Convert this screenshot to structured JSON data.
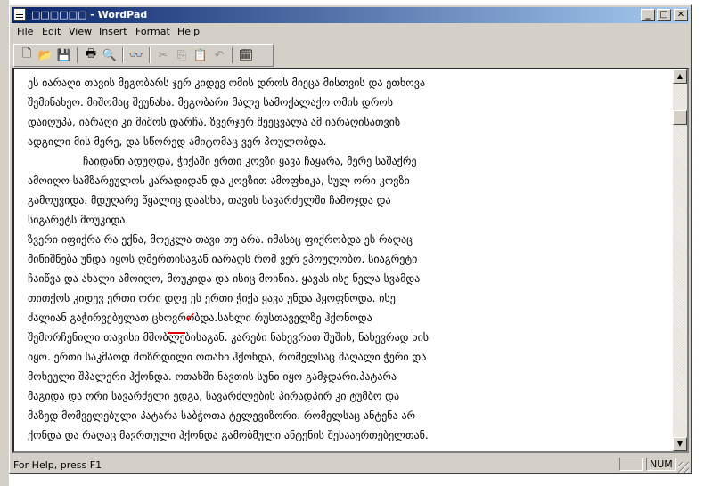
{
  "window": {
    "title": "□□□□□□ - WordPad",
    "minimize_icon": "minimize-icon",
    "maximize_icon": "maximize-icon",
    "close_icon": "close-icon"
  },
  "menu": [
    "File",
    "Edit",
    "View",
    "Insert",
    "Format",
    "Help"
  ],
  "toolbar": [
    {
      "name": "new-icon",
      "glyph": "🗋"
    },
    {
      "name": "open-icon",
      "glyph": "📂"
    },
    {
      "name": "save-icon",
      "glyph": "💾"
    },
    {
      "name": "print-icon",
      "glyph": "🖶"
    },
    {
      "name": "print-preview-icon",
      "glyph": "🔍"
    },
    {
      "name": "find-icon",
      "glyph": "👓"
    },
    {
      "name": "cut-icon",
      "glyph": "✂"
    },
    {
      "name": "copy-icon",
      "glyph": "⎘"
    },
    {
      "name": "paste-icon",
      "glyph": "📋"
    },
    {
      "name": "undo-icon",
      "glyph": "↶"
    },
    {
      "name": "date-time-icon",
      "glyph": "🗓"
    }
  ],
  "document": {
    "lines": [
      "ეს იარაღი თავის მეგობარს ჯერ კიდევ ომის დროს მიეცა მისთვის და ეთხოვა",
      "შემინახეო. მიშომაც შეუნახა. მეგობარი მალე სამოქალაქო ომის დროს",
      "დაიღუპა, იარაღი კი მიშოს დარჩა. ზვერჯერ შეეცვალა ამ იარაღისათვის",
      "ადგილი მის მერე, და სწორედ ამიტომაც ვერ პოულობდა.",
      "ჩაიდანი ადუღდა, ჭიქაში ერთი კოვზი ყავა ჩაყარა, მერე საშაქრე",
      "ამოიღო სამზარეულოს კარადიდან და კოვზით ამოფხიკა, სულ ორი კოვზი",
      "გამოუვიდა. მდუღარე წყალიც დაასხა, თავის სავარძელში ჩამოჯდა და",
      "სიგარეტს მოუკიდა.",
      "ზვერი იფიქრა რა ექნა, მოეკლა თავი თუ არა. იმასაც ფიქრობდა ეს რაღაც",
      "მინიშნება უნდა იყოს ღმერთისაგან იარაღს რომ ვერ ვპოულობო. სიაგრეტი",
      "ჩაიწვა და ახალი ამოიღო, მოუკიდა და ისიც მოიწია. ყავას ისე ნელა სვამდა",
      "თითქოს კიდევ ერთი ორი დღე ეს ერთი ჭიქა ყავა უნდა ჰყოფნოდა. ისე",
      "ძალიან გაჭირვებულათ ცხოვრობდა.სახლი რუსთაველზე ჰქონოდა",
      "შემორჩენილი თავისი მშობლებისაგან. კარები ნახევრათ შუშის, ნახევრად ხის",
      "იყო. ერთი საკმაოდ მოზრდილი ოთახი ჰქონდა, რომელსაც მაღალი ჭერი და",
      "მოხეული შპალერი ჰქონდა. ოთახში ნავთის სუნი იყო გამჯდარი.პატარა",
      "მაგიდა და ორი სავარძელი ედგა, სავარძლების პირადპირ კი ტუმბო და",
      "მაზედ მომველებული პატარა საბჭოთა ტელევიზორი. რომელსაც ანტენა არ",
      "ქონდა და რაღაც მავრთული ჰქონდა გამობმული ანტენის შესააერთებელთან."
    ]
  },
  "status": {
    "help_text": "For Help, press F1",
    "num": "NUM"
  }
}
